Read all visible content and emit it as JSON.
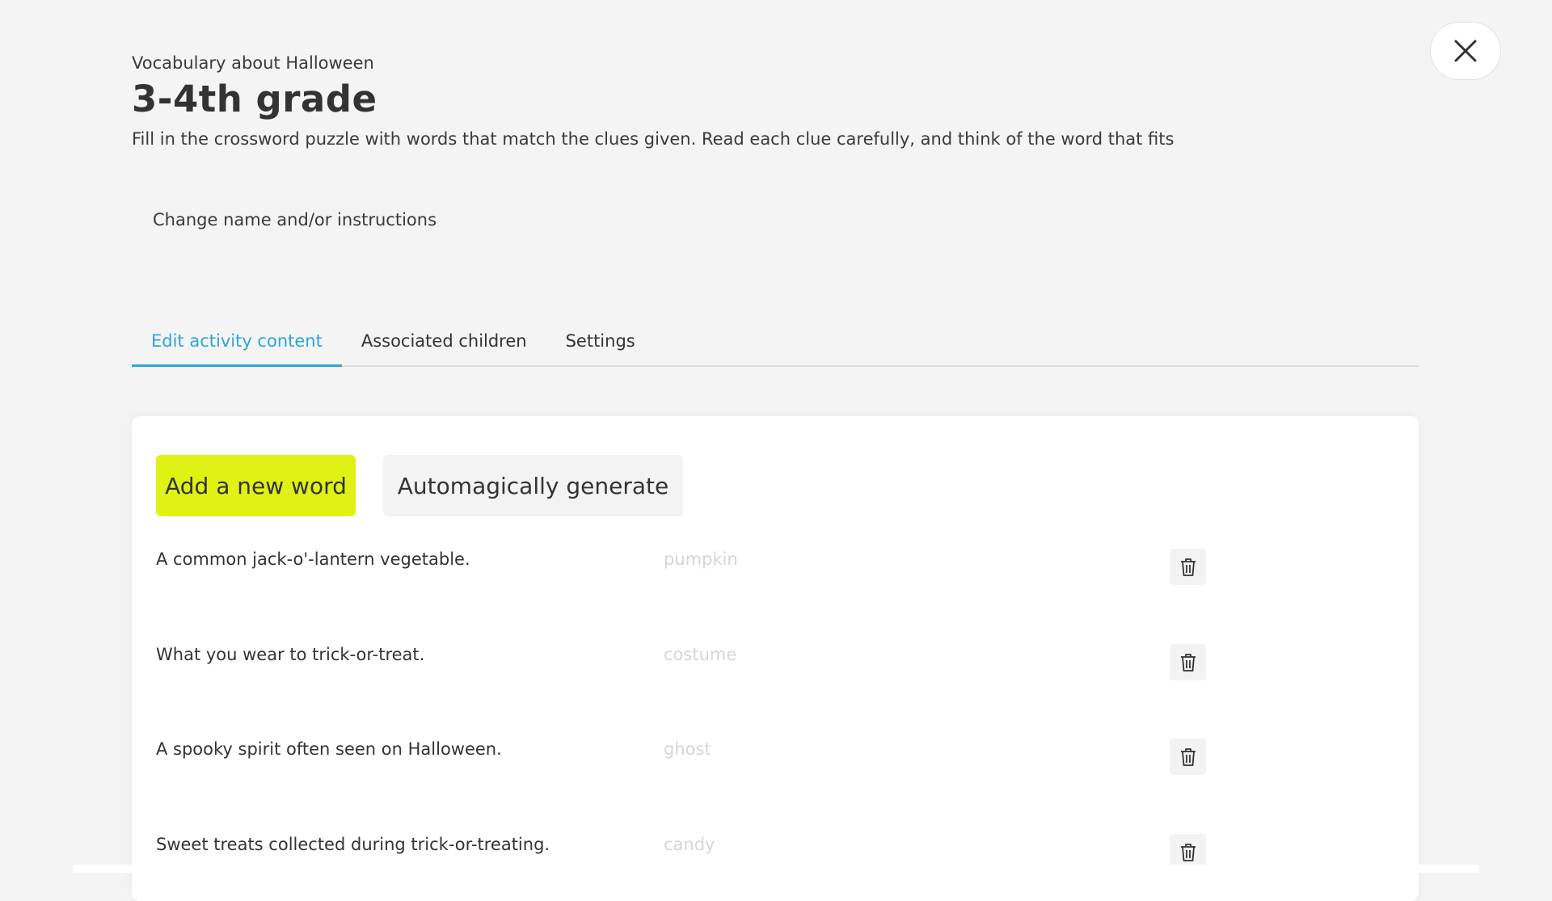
{
  "header": {
    "subtitle": "Vocabulary about Halloween",
    "title": "3-4th grade",
    "instructions": "Fill in the crossword puzzle with words that match the clues given. Read each clue carefully, and think of the word that fits",
    "change_link": "Change name and/or instructions",
    "close_icon": "close-icon"
  },
  "tabs": [
    {
      "label": "Edit activity content",
      "active": true
    },
    {
      "label": "Associated children",
      "active": false
    },
    {
      "label": "Settings",
      "active": false
    }
  ],
  "toolbar": {
    "add_label": "Add a new word",
    "generate_label": "Automagically generate"
  },
  "words": [
    {
      "clue": "A common jack-o'-lantern vegetable.",
      "answer": "pumpkin"
    },
    {
      "clue": "What you wear to trick-or-treat.",
      "answer": "costume"
    },
    {
      "clue": "A spooky spirit often seen on Halloween.",
      "answer": "ghost"
    },
    {
      "clue": "Sweet treats collected during trick-or-treating.",
      "answer": "candy"
    }
  ],
  "colors": {
    "accent": "#2aa7d8",
    "primary_button": "#e0f114",
    "background": "#f4f4f4"
  }
}
